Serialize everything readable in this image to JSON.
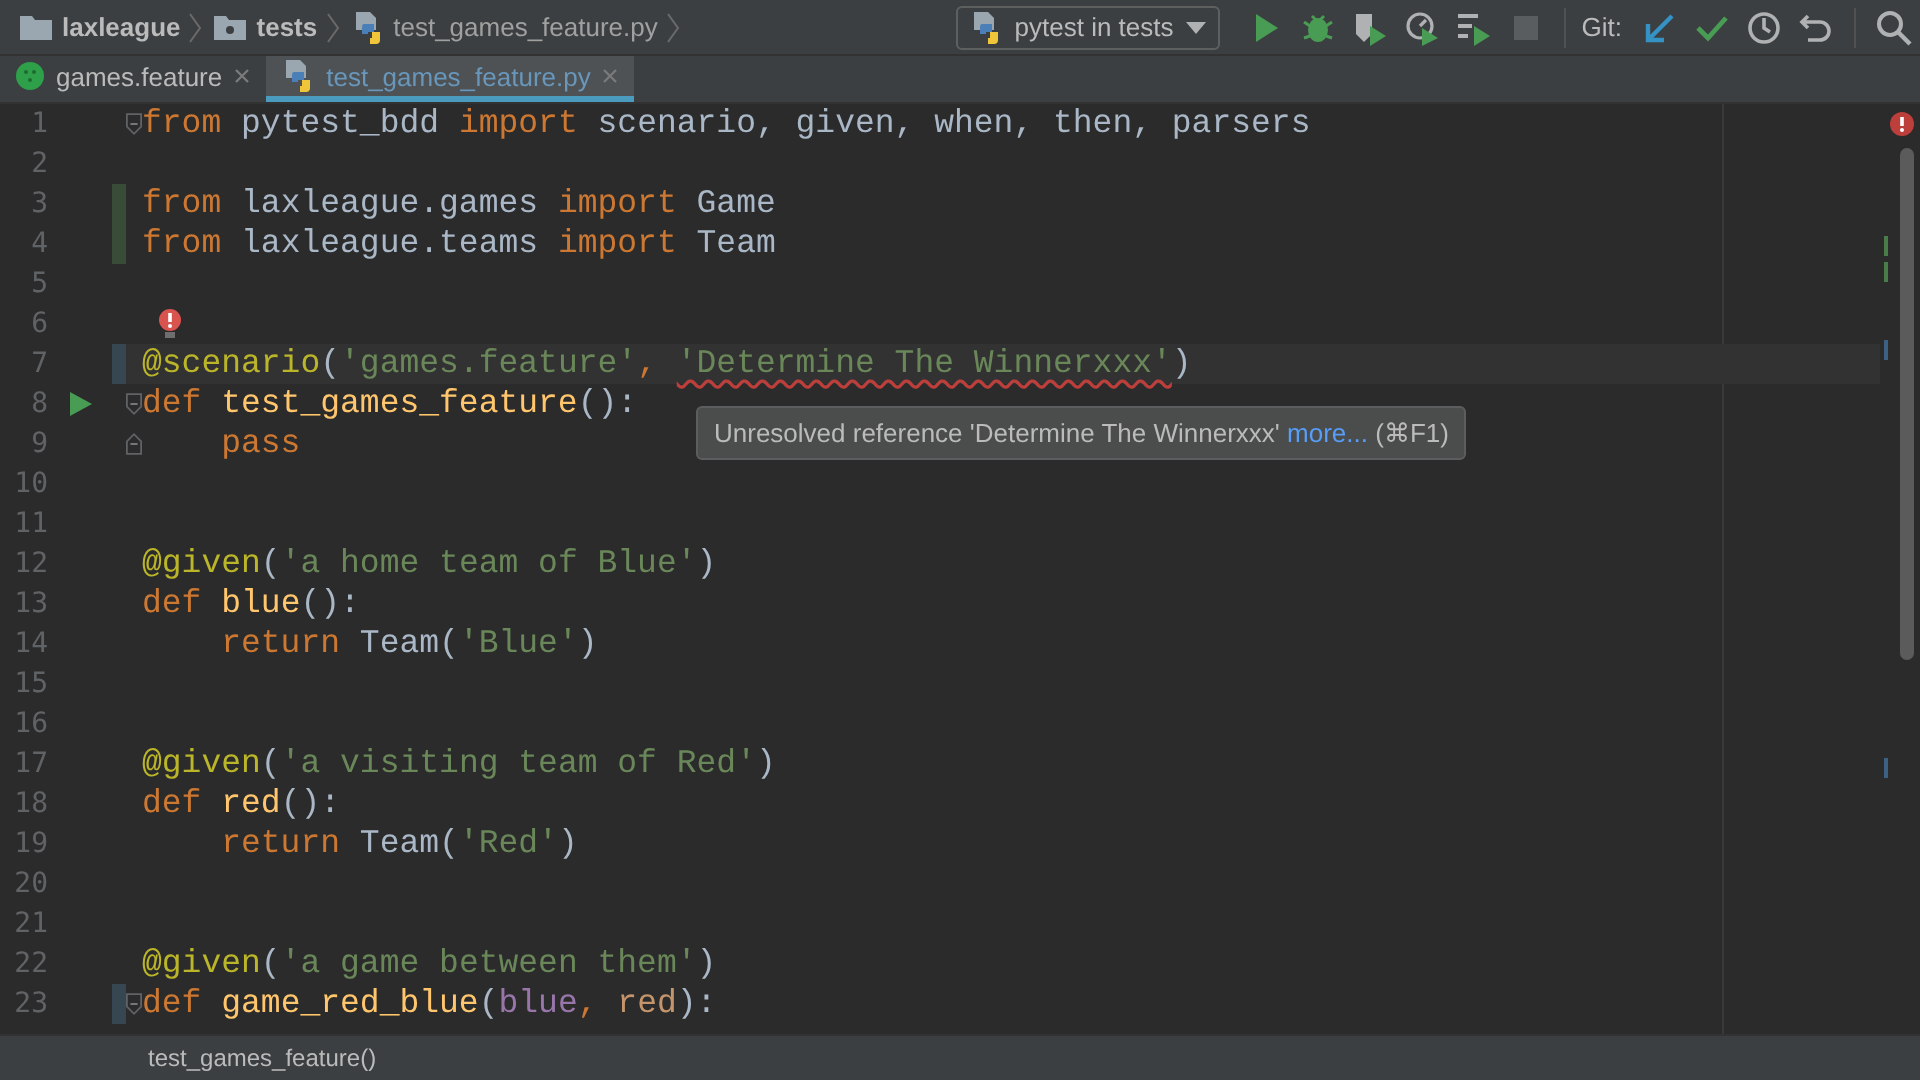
{
  "breadcrumbs": [
    {
      "kind": "project",
      "label": "laxleague"
    },
    {
      "kind": "folder",
      "label": "tests"
    },
    {
      "kind": "python",
      "label": "test_games_feature.py"
    }
  ],
  "run_config": {
    "label": "pytest in tests"
  },
  "actions": [
    {
      "kind": "run",
      "disabled": false
    },
    {
      "kind": "debug",
      "disabled": false
    },
    {
      "kind": "coverage",
      "disabled": false
    },
    {
      "kind": "profile",
      "disabled": false
    },
    {
      "kind": "concurrency",
      "disabled": false
    },
    {
      "kind": "stop",
      "disabled": true
    }
  ],
  "git": {
    "label": "Git:",
    "actions": [
      {
        "kind": "update"
      },
      {
        "kind": "commit"
      },
      {
        "kind": "history"
      },
      {
        "kind": "revert"
      }
    ]
  },
  "tabs": [
    {
      "kind": "feature",
      "label": "games.feature",
      "selected": false
    },
    {
      "kind": "python",
      "label": "test_games_feature.py",
      "selected": true
    }
  ],
  "lines": [
    {
      "number": "1",
      "fold_start": true,
      "tokens": [
        {
          "text": "from",
          "kind": "keyword"
        },
        {
          "text": " pytest_bdd ",
          "kind": "plain"
        },
        {
          "text": "import",
          "kind": "keyword"
        },
        {
          "text": " scenario, given, when, then, parsers",
          "kind": "plain"
        }
      ]
    },
    {
      "number": "2"
    },
    {
      "number": "3",
      "added": true,
      "tokens": [
        {
          "text": "from",
          "kind": "keyword"
        },
        {
          "text": " laxleague.games ",
          "kind": "plain"
        },
        {
          "text": "import",
          "kind": "keyword"
        },
        {
          "text": " Game",
          "kind": "plain"
        }
      ]
    },
    {
      "number": "4",
      "added": true,
      "tokens": [
        {
          "text": "from",
          "kind": "keyword"
        },
        {
          "text": " laxleague.teams ",
          "kind": "plain"
        },
        {
          "text": "import",
          "kind": "keyword"
        },
        {
          "text": " Team",
          "kind": "plain"
        }
      ]
    },
    {
      "number": "5"
    },
    {
      "number": "6",
      "bulb": true
    },
    {
      "number": "7",
      "modified": true,
      "current": true,
      "tokens": [
        {
          "text": "@scenario",
          "kind": "decorator"
        },
        {
          "text": "(",
          "kind": "plain"
        },
        {
          "text": "'games.feature'",
          "kind": "string"
        },
        {
          "text": ", ",
          "kind": "keyword"
        },
        {
          "text": "'Determine The Winnerxxx'",
          "kind": "string",
          "error": true
        },
        {
          "text": ")",
          "kind": "plain"
        }
      ]
    },
    {
      "number": "8",
      "run": true,
      "fold_start": true,
      "tokens": [
        {
          "text": "def ",
          "kind": "keyword"
        },
        {
          "text": "test_games_feature",
          "kind": "function"
        },
        {
          "text": "():",
          "kind": "plain"
        }
      ]
    },
    {
      "number": "9",
      "fold_end": true,
      "indented": true,
      "tokens": [
        {
          "text": "pass",
          "kind": "keyword"
        }
      ]
    },
    {
      "number": "10"
    },
    {
      "number": "11"
    },
    {
      "number": "12",
      "tokens": [
        {
          "text": "@given",
          "kind": "decorator"
        },
        {
          "text": "(",
          "kind": "plain"
        },
        {
          "text": "'a home team of Blue'",
          "kind": "string"
        },
        {
          "text": ")",
          "kind": "plain"
        }
      ]
    },
    {
      "number": "13",
      "tokens": [
        {
          "text": "def ",
          "kind": "keyword"
        },
        {
          "text": "blue",
          "kind": "function"
        },
        {
          "text": "():",
          "kind": "plain"
        }
      ]
    },
    {
      "number": "14",
      "indented": true,
      "tokens": [
        {
          "text": "return",
          "kind": "keyword"
        },
        {
          "text": " Team(",
          "kind": "plain"
        },
        {
          "text": "'Blue'",
          "kind": "string"
        },
        {
          "text": ")",
          "kind": "plain"
        }
      ]
    },
    {
      "number": "15"
    },
    {
      "number": "16"
    },
    {
      "number": "17",
      "tokens": [
        {
          "text": "@given",
          "kind": "decorator"
        },
        {
          "text": "(",
          "kind": "plain"
        },
        {
          "text": "'a visiting team of Red'",
          "kind": "string"
        },
        {
          "text": ")",
          "kind": "plain"
        }
      ]
    },
    {
      "number": "18",
      "tokens": [
        {
          "text": "def ",
          "kind": "keyword"
        },
        {
          "text": "red",
          "kind": "function"
        },
        {
          "text": "():",
          "kind": "plain"
        }
      ]
    },
    {
      "number": "19",
      "indented": true,
      "tokens": [
        {
          "text": "return",
          "kind": "keyword"
        },
        {
          "text": " Team(",
          "kind": "plain"
        },
        {
          "text": "'Red'",
          "kind": "string"
        },
        {
          "text": ")",
          "kind": "plain"
        }
      ]
    },
    {
      "number": "20"
    },
    {
      "number": "21"
    },
    {
      "number": "22",
      "tokens": [
        {
          "text": "@given",
          "kind": "decorator"
        },
        {
          "text": "(",
          "kind": "plain"
        },
        {
          "text": "'a game between them'",
          "kind": "string"
        },
        {
          "text": ")",
          "kind": "plain"
        }
      ]
    },
    {
      "number": "23",
      "modified": true,
      "fold_start": true,
      "tokens": [
        {
          "text": "def ",
          "kind": "keyword"
        },
        {
          "text": "game_red_blue",
          "kind": "function"
        },
        {
          "text": "(",
          "kind": "plain"
        },
        {
          "text": "blue",
          "kind": "param"
        },
        {
          "text": ", ",
          "kind": "keyword"
        },
        {
          "text": "red",
          "kind": "param_warm"
        },
        {
          "text": "):",
          "kind": "plain"
        }
      ]
    }
  ],
  "tooltip": {
    "message": "Unresolved reference 'Determine The Winnerxxx'",
    "link": "more...",
    "shortcut": "(⌘F1)"
  },
  "status_bar": {
    "text": "test_games_feature()"
  }
}
